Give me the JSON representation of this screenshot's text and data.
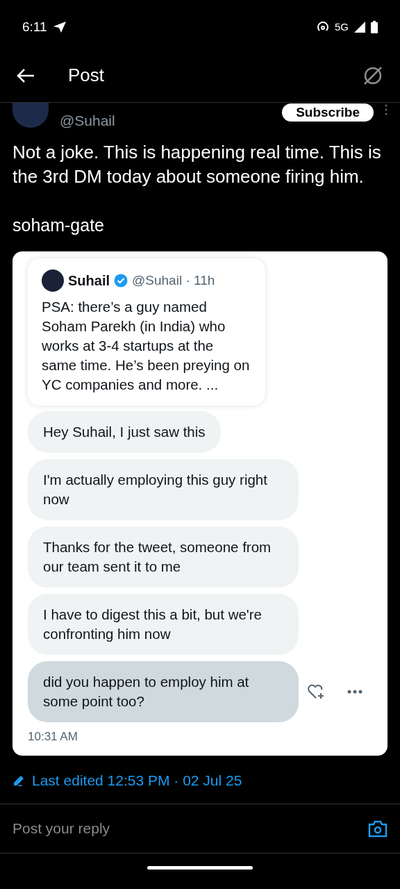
{
  "status_bar": {
    "time": "6:11",
    "network": "5G"
  },
  "header": {
    "title": "Post"
  },
  "author": {
    "handle": "@Suhail",
    "subscribe": "Subscribe"
  },
  "post": {
    "text": "Not a joke. This is happening real time. This is the 3rd DM today about someone firing him.",
    "tag": "soham-gate"
  },
  "screenshot": {
    "quote": {
      "name": "Suhail",
      "handle": "@Suhail",
      "time": "· 11h",
      "text": "PSA: there’s a guy named Soham Parekh (in India) who works at 3-4 startups at the same time. He’s been preying on YC companies and more. ..."
    },
    "messages": [
      {
        "text": "Hey Suhail, I just saw this",
        "selected": false
      },
      {
        "text": "I'm actually employing this guy right now",
        "selected": false
      },
      {
        "text": "Thanks for the tweet, someone from our team sent it to me",
        "selected": false
      },
      {
        "text": "I have to digest this a bit, but we're confronting him now",
        "selected": false
      },
      {
        "text": "did you happen to employ him at some point too?",
        "selected": true
      }
    ],
    "timestamp": "10:31 AM"
  },
  "edited": "Last edited 12:53 PM · 02 Jul 25",
  "reply": {
    "placeholder": "Post your reply"
  }
}
